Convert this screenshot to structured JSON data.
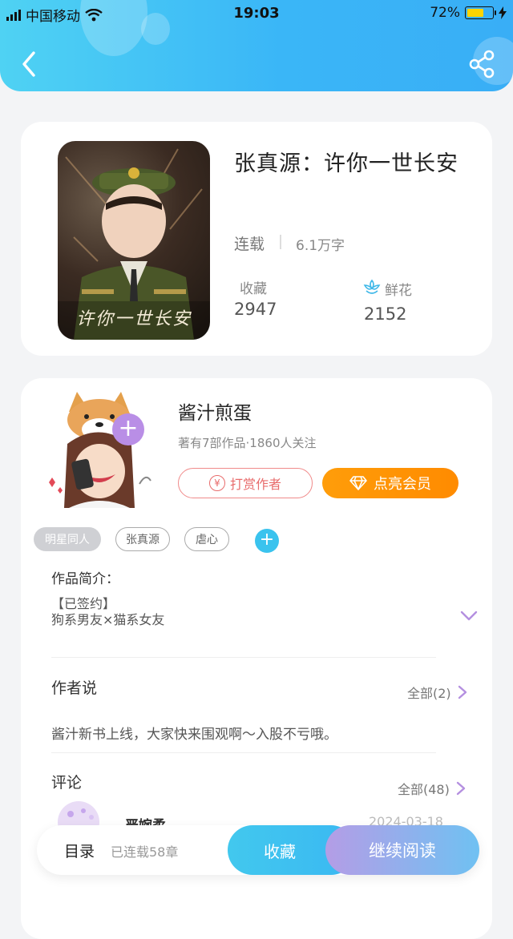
{
  "status_bar": {
    "carrier": "中国移动",
    "time": "19:03",
    "battery": "72%",
    "battery_level": 0.72
  },
  "header": {
    "back_icon": "chevron-left-icon",
    "share_icon": "share-icon"
  },
  "book": {
    "title": "张真源：许你一世长安",
    "cover_text": "许你一世长安",
    "status": "连载",
    "word_count": "6.1万字",
    "favorites_label": "收藏",
    "favorites_count": "2947",
    "flowers_label": "鲜花",
    "flowers_count": "2152"
  },
  "author": {
    "name": "酱汁煎蛋",
    "stats": "著有7部作品·1860人关注",
    "tip_label": "打赏作者",
    "vip_label": "点亮会员"
  },
  "tags": [
    "明星同人",
    "张真源",
    "虐心"
  ],
  "intro": {
    "label": "作品简介：",
    "line1": "【已签约】",
    "line2": "狗系男友×猫系女友"
  },
  "author_says": {
    "title": "作者说",
    "all_label": "全部(2)",
    "content": "酱汁新书上线，大家快来围观啊～入股不亏哦。"
  },
  "comments": {
    "title": "评论",
    "all_label": "全部(48)",
    "first_name": "严婉柔",
    "first_date": "2024-03-18"
  },
  "bottom_bar": {
    "toc_label": "目录",
    "chapter_count": "已连载58章",
    "collect_label": "收藏",
    "read_label": "继续阅读"
  },
  "colors": {
    "header_gradient_start": "#4fd2f3",
    "header_gradient_end": "#39aef6",
    "vip_orange": "#ff9d0a",
    "tip_red": "#e86c6c",
    "accent_purple": "#b98ee6"
  }
}
